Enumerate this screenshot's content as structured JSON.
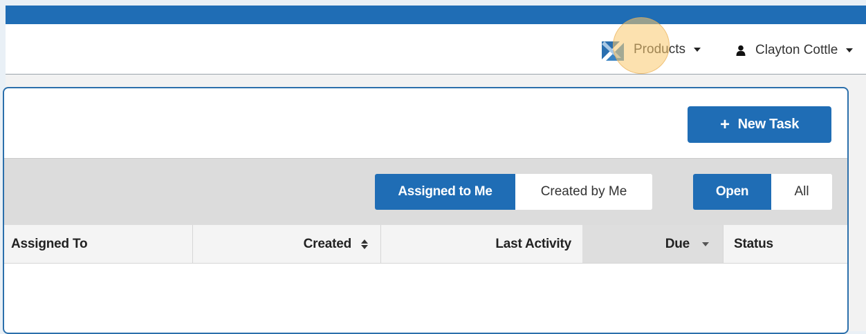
{
  "header": {
    "products_label": "Products",
    "user_name": "Clayton Cottle"
  },
  "toolbar": {
    "new_task_label": "New Task"
  },
  "filters": {
    "ownership": {
      "options": [
        "Assigned to Me",
        "Created by Me"
      ],
      "selected": "Assigned to Me"
    },
    "state": {
      "options": [
        "Open",
        "All"
      ],
      "selected": "Open"
    }
  },
  "table": {
    "columns": [
      "Assigned To",
      "Created",
      "Last Activity",
      "Due",
      "Status"
    ],
    "sorted_column": "Due",
    "rows": []
  },
  "colors": {
    "brand": "#1f6db5",
    "panel_border": "#2b6fab",
    "highlight": "#f6c76e"
  }
}
